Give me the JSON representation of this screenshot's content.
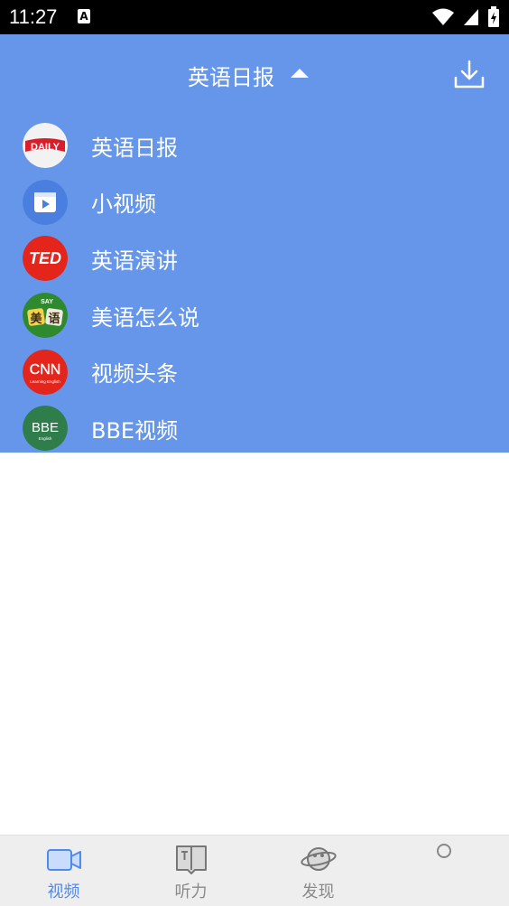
{
  "status_bar": {
    "time": "11:27",
    "notification_icon": "A"
  },
  "header": {
    "title": "英语日报"
  },
  "menu": {
    "items": [
      {
        "label": "英语日报"
      },
      {
        "label": "小视频"
      },
      {
        "label": "英语演讲"
      },
      {
        "label": "美语怎么说"
      },
      {
        "label": "视频头条"
      },
      {
        "label": "BBE视频"
      }
    ],
    "icons": {
      "daily": "DAILY",
      "ted": "TED",
      "meiyu_top": "SAY",
      "meiyu_a": "美",
      "meiyu_b": "语",
      "cnn": "CNN",
      "cnn_sub": "Learning English",
      "bbe": "BBE",
      "bbe_sub": "English"
    }
  },
  "bottom_nav": {
    "tabs": [
      {
        "label": "视频",
        "icon": "video-camera-icon"
      },
      {
        "label": "听力",
        "icon": "book-icon"
      },
      {
        "label": "发现",
        "icon": "planet-icon"
      }
    ]
  },
  "colors": {
    "header_bg": "#6596ea",
    "active_tab": "#4d8bf0",
    "inactive_tab": "#8a8a8a"
  }
}
